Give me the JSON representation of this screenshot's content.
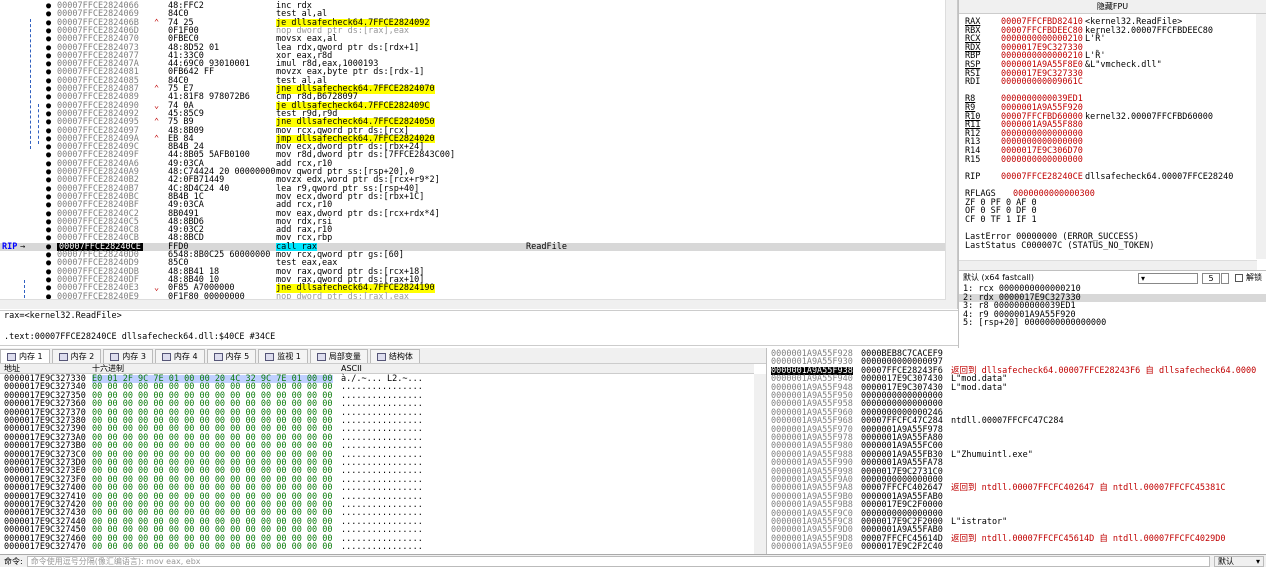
{
  "disasm": {
    "rows": [
      {
        "addr": "00007FFCE2824066",
        "bytes": "48:FFC2",
        "ins": "inc rdx",
        "cmt": "",
        "hl": "",
        "arrow": ""
      },
      {
        "addr": "00007FFCE2824069",
        "bytes": "84C0",
        "ins": "test al,al",
        "cmt": "",
        "hl": "",
        "arrow": ""
      },
      {
        "addr": "00007FFCE282406B",
        "bytes": "74 25",
        "ins": "je dllsafecheck64.7FFCE2824092",
        "cmt": "",
        "hl": "yellow",
        "arrow": "^"
      },
      {
        "addr": "00007FFCE282406D",
        "bytes": "0F1F00",
        "ins": "nop dword ptr ds:[rax],eax",
        "cmt": "",
        "hl": "nop",
        "arrow": ""
      },
      {
        "addr": "00007FFCE2824070",
        "bytes": "0FBEC0",
        "ins": "movsx eax,al",
        "cmt": "",
        "hl": "",
        "arrow": ""
      },
      {
        "addr": "00007FFCE2824073",
        "bytes": "48:8D52 01",
        "ins": "lea rdx,qword ptr ds:[rdx+1]",
        "cmt": "",
        "hl": "",
        "arrow": ""
      },
      {
        "addr": "00007FFCE2824077",
        "bytes": "41:33C0",
        "ins": "xor eax,r8d",
        "cmt": "",
        "hl": "",
        "arrow": ""
      },
      {
        "addr": "00007FFCE282407A",
        "bytes": "44:69C0 93010001",
        "ins": "imul r8d,eax,1000193",
        "cmt": "",
        "hl": "",
        "arrow": ""
      },
      {
        "addr": "00007FFCE2824081",
        "bytes": "0FB642 FF",
        "ins": "movzx eax,byte ptr ds:[rdx-1]",
        "cmt": "",
        "hl": "",
        "arrow": ""
      },
      {
        "addr": "00007FFCE2824085",
        "bytes": "84C0",
        "ins": "test al,al",
        "cmt": "",
        "hl": "",
        "arrow": ""
      },
      {
        "addr": "00007FFCE2824087",
        "bytes": "75 E7",
        "ins": "jne dllsafecheck64.7FFCE2824070",
        "cmt": "",
        "hl": "yellow",
        "arrow": "^"
      },
      {
        "addr": "00007FFCE2824089",
        "bytes": "41:81F8 978072B6",
        "ins": "cmp r8d,B6728097",
        "cmt": "",
        "hl": "",
        "arrow": ""
      },
      {
        "addr": "00007FFCE2824090",
        "bytes": "74 0A",
        "ins": "je dllsafecheck64.7FFCE282409C",
        "cmt": "",
        "hl": "yellow",
        "arrow": "v"
      },
      {
        "addr": "00007FFCE2824092",
        "bytes": "45:85C9",
        "ins": "test r9d,r9d",
        "cmt": "",
        "hl": "",
        "arrow": ""
      },
      {
        "addr": "00007FFCE2824095",
        "bytes": "75 B9",
        "ins": "jne dllsafecheck64.7FFCE2824050",
        "cmt": "",
        "hl": "yellow",
        "arrow": "^"
      },
      {
        "addr": "00007FFCE2824097",
        "bytes": "48:8B09",
        "ins": "mov rcx,qword ptr ds:[rcx]",
        "cmt": "",
        "hl": "",
        "arrow": ""
      },
      {
        "addr": "00007FFCE282409A",
        "bytes": "EB 84",
        "ins": "jmp dllsafecheck64.7FFCE2824020",
        "cmt": "",
        "hl": "yellow",
        "arrow": "^"
      },
      {
        "addr": "00007FFCE282409C",
        "bytes": "8B4B 24",
        "ins": "mov ecx,dword ptr ds:[rbx+24]",
        "cmt": "",
        "hl": "",
        "arrow": ""
      },
      {
        "addr": "00007FFCE282409F",
        "bytes": "44:8B05 5AFB0100",
        "ins": "mov r8d,dword ptr ds:[7FFCE2843C00]",
        "cmt": "",
        "hl": "",
        "arrow": ""
      },
      {
        "addr": "00007FFCE28240A6",
        "bytes": "49:03CA",
        "ins": "add rcx,r10",
        "cmt": "",
        "hl": "",
        "arrow": ""
      },
      {
        "addr": "00007FFCE28240A9",
        "bytes": "48:C74424 20 00000000",
        "ins": "mov qword ptr ss:[rsp+20],0",
        "cmt": "",
        "hl": "",
        "arrow": ""
      },
      {
        "addr": "00007FFCE28240B2",
        "bytes": "42:0FB71449",
        "ins": "movzx edx,word ptr ds:[rcx+r9*2]",
        "cmt": "",
        "hl": "",
        "arrow": ""
      },
      {
        "addr": "00007FFCE28240B7",
        "bytes": "4C:8D4C24 40",
        "ins": "lea r9,qword ptr ss:[rsp+40]",
        "cmt": "",
        "hl": "",
        "arrow": ""
      },
      {
        "addr": "00007FFCE28240BC",
        "bytes": "8B4B 1C",
        "ins": "mov ecx,dword ptr ds:[rbx+1C]",
        "cmt": "",
        "hl": "",
        "arrow": ""
      },
      {
        "addr": "00007FFCE28240BF",
        "bytes": "49:03CA",
        "ins": "add rcx,r10",
        "cmt": "",
        "hl": "",
        "arrow": ""
      },
      {
        "addr": "00007FFCE28240C2",
        "bytes": "8B0491",
        "ins": "mov eax,dword ptr ds:[rcx+rdx*4]",
        "cmt": "",
        "hl": "",
        "arrow": ""
      },
      {
        "addr": "00007FFCE28240C5",
        "bytes": "48:8BD6",
        "ins": "mov rdx,rsi",
        "cmt": "",
        "hl": "",
        "arrow": ""
      },
      {
        "addr": "00007FFCE28240C8",
        "bytes": "49:03C2",
        "ins": "add rax,r10",
        "cmt": "",
        "hl": "",
        "arrow": ""
      },
      {
        "addr": "00007FFCE28240CB",
        "bytes": "48:8BCD",
        "ins": "mov rcx,rbp",
        "cmt": "",
        "hl": "",
        "arrow": ""
      },
      {
        "addr": "00007FFCE28240CE",
        "bytes": "FFD0",
        "ins": "call rax",
        "cmt": "ReadFile",
        "hl": "call",
        "arrow": "",
        "rip": true
      },
      {
        "addr": "00007FFCE28240D0",
        "bytes": "6548:8B0C25 60000000",
        "ins": "mov rcx,qword ptr gs:[60]",
        "cmt": "",
        "hl": "",
        "arrow": ""
      },
      {
        "addr": "00007FFCE28240D9",
        "bytes": "85C0",
        "ins": "test eax,eax",
        "cmt": "",
        "hl": "",
        "arrow": ""
      },
      {
        "addr": "00007FFCE28240DB",
        "bytes": "48:8B41 18",
        "ins": "mov rax,qword ptr ds:[rcx+18]",
        "cmt": "",
        "hl": "",
        "arrow": ""
      },
      {
        "addr": "00007FFCE28240DF",
        "bytes": "48:8B40 10",
        "ins": "mov rax,qword ptr ds:[rax+10]",
        "cmt": "",
        "hl": "",
        "arrow": ""
      },
      {
        "addr": "00007FFCE28240E3",
        "bytes": "0F85 A7000000",
        "ins": "jne dllsafecheck64.7FFCE2824190",
        "cmt": "",
        "hl": "yellow",
        "arrow": "v"
      },
      {
        "addr": "00007FFCE28240E9",
        "bytes": "0F1F80 00000000",
        "ins": "nop dword ptr ds:[rax],eax",
        "cmt": "",
        "hl": "nop",
        "arrow": ""
      }
    ],
    "rip_label": "RIP"
  },
  "info": {
    "line1": "rax=<kernel32.ReadFile>",
    "line2": ".text:00007FFCE28240CE dllsafecheck64.dll:$40CE #34CE"
  },
  "regs": {
    "title": "隐藏FPU",
    "rows": [
      {
        "n": "RAX",
        "v": "00007FFCFBD82410",
        "c": "<kernel32.ReadFile>",
        "u": true
      },
      {
        "n": "RBX",
        "v": "00007FFCFBDEEC80",
        "c": "kernel32.00007FFCFBDEEC80",
        "u": false
      },
      {
        "n": "RCX",
        "v": "0000000000000210",
        "c": "L'Ȑ'",
        "u": true
      },
      {
        "n": "RDX",
        "v": "0000017E9C327330",
        "c": "",
        "u": true
      },
      {
        "n": "RBP",
        "v": "0000000000000210",
        "c": "L'Ȑ'",
        "u": false
      },
      {
        "n": "RSP",
        "v": "0000001A9A55F8E0",
        "c": "&L\"vmcheck.dll\"",
        "u": true
      },
      {
        "n": "RSI",
        "v": "0000017E9C327330",
        "c": "",
        "u": false
      },
      {
        "n": "RDI",
        "v": "000000000009061C",
        "c": "",
        "u": false
      },
      {
        "n": "",
        "v": "",
        "c": "",
        "u": false
      },
      {
        "n": "R8",
        "v": "0000000000039ED1",
        "c": "",
        "u": true
      },
      {
        "n": "R9",
        "v": "0000001A9A55F920",
        "c": "",
        "u": true
      },
      {
        "n": "R10",
        "v": "00007FFCFBD60000",
        "c": "kernel32.00007FFCFBD60000",
        "u": true
      },
      {
        "n": "R11",
        "v": "0000001A9A55F880",
        "c": "",
        "u": true
      },
      {
        "n": "R12",
        "v": "0000000000000000",
        "c": "",
        "u": false
      },
      {
        "n": "R13",
        "v": "0000000000000000",
        "c": "",
        "u": false
      },
      {
        "n": "R14",
        "v": "0000017E9C306D70",
        "c": "",
        "u": false
      },
      {
        "n": "R15",
        "v": "0000000000000000",
        "c": "",
        "u": false
      },
      {
        "n": "",
        "v": "",
        "c": "",
        "u": false
      },
      {
        "n": "RIP",
        "v": "00007FFCE28240CE",
        "c": "dllsafecheck64.00007FFCE28240",
        "u": false
      },
      {
        "n": "",
        "v": "",
        "c": "",
        "u": false
      },
      {
        "n": "RFLAGS",
        "v": "0000000000000300",
        "c": "",
        "u": false
      },
      {
        "n": "ZF 0  PF 0  AF 0",
        "v": "",
        "c": "",
        "u": false,
        "plain": true
      },
      {
        "n": "OF 0  SF 0  DF 0",
        "v": "",
        "c": "",
        "u": false,
        "plain": true
      },
      {
        "n": "CF 0  TF 1  IF 1",
        "v": "",
        "c": "",
        "u": false,
        "plain": true
      },
      {
        "n": "",
        "v": "",
        "c": "",
        "u": false
      },
      {
        "n": "LastError  00000000 (ERROR_SUCCESS)",
        "v": "",
        "c": "",
        "u": false,
        "plain": true
      },
      {
        "n": "LastStatus C000007C (STATUS_NO_TOKEN)",
        "v": "",
        "c": "",
        "u": false,
        "plain": true
      }
    ]
  },
  "callconv": {
    "label": "默认 (x64 fastcall)",
    "count": "5",
    "lock_label": "解锁",
    "rows": [
      "1: rcx 0000000000000210",
      "2: rdx 0000017E9C327330",
      "3: r8 0000000000039ED1",
      "4: r9 0000001A9A55F920",
      "5: [rsp+20] 0000000000000000"
    ],
    "selected": 1
  },
  "tabs": [
    {
      "label": "内存 1",
      "active": true
    },
    {
      "label": "内存 2",
      "active": false
    },
    {
      "label": "内存 3",
      "active": false
    },
    {
      "label": "内存 4",
      "active": false
    },
    {
      "label": "内存 5",
      "active": false
    },
    {
      "label": "监视 1",
      "active": false
    },
    {
      "label": "局部变量",
      "active": false
    },
    {
      "label": "结构体",
      "active": false
    }
  ],
  "dump": {
    "head_addr": "地址",
    "head_hex": "十六进制",
    "head_ascii": "ASCII",
    "rows": [
      {
        "a": "0000017E9C327330",
        "h": "E0 01 2F 9C 7E 01 00 00 20 4C 32 9C 7E 01 00 00",
        "c": "à./.~... L2.~..."
      },
      {
        "a": "0000017E9C327340",
        "h": "00 00 00 00 00 00 00 00 00 00 00 00 00 00 00 00",
        "c": "................"
      },
      {
        "a": "0000017E9C327350",
        "h": "00 00 00 00 00 00 00 00 00 00 00 00 00 00 00 00",
        "c": "................"
      },
      {
        "a": "0000017E9C327360",
        "h": "00 00 00 00 00 00 00 00 00 00 00 00 00 00 00 00",
        "c": "................"
      },
      {
        "a": "0000017E9C327370",
        "h": "00 00 00 00 00 00 00 00 00 00 00 00 00 00 00 00",
        "c": "................"
      },
      {
        "a": "0000017E9C327380",
        "h": "00 00 00 00 00 00 00 00 00 00 00 00 00 00 00 00",
        "c": "................"
      },
      {
        "a": "0000017E9C327390",
        "h": "00 00 00 00 00 00 00 00 00 00 00 00 00 00 00 00",
        "c": "................"
      },
      {
        "a": "0000017E9C3273A0",
        "h": "00 00 00 00 00 00 00 00 00 00 00 00 00 00 00 00",
        "c": "................"
      },
      {
        "a": "0000017E9C3273B0",
        "h": "00 00 00 00 00 00 00 00 00 00 00 00 00 00 00 00",
        "c": "................"
      },
      {
        "a": "0000017E9C3273C0",
        "h": "00 00 00 00 00 00 00 00 00 00 00 00 00 00 00 00",
        "c": "................"
      },
      {
        "a": "0000017E9C3273D0",
        "h": "00 00 00 00 00 00 00 00 00 00 00 00 00 00 00 00",
        "c": "................"
      },
      {
        "a": "0000017E9C3273E0",
        "h": "00 00 00 00 00 00 00 00 00 00 00 00 00 00 00 00",
        "c": "................"
      },
      {
        "a": "0000017E9C3273F0",
        "h": "00 00 00 00 00 00 00 00 00 00 00 00 00 00 00 00",
        "c": "................"
      },
      {
        "a": "0000017E9C327400",
        "h": "00 00 00 00 00 00 00 00 00 00 00 00 00 00 00 00",
        "c": "................"
      },
      {
        "a": "0000017E9C327410",
        "h": "00 00 00 00 00 00 00 00 00 00 00 00 00 00 00 00",
        "c": "................"
      },
      {
        "a": "0000017E9C327420",
        "h": "00 00 00 00 00 00 00 00 00 00 00 00 00 00 00 00",
        "c": "................"
      },
      {
        "a": "0000017E9C327430",
        "h": "00 00 00 00 00 00 00 00 00 00 00 00 00 00 00 00",
        "c": "................"
      },
      {
        "a": "0000017E9C327440",
        "h": "00 00 00 00 00 00 00 00 00 00 00 00 00 00 00 00",
        "c": "................"
      },
      {
        "a": "0000017E9C327450",
        "h": "00 00 00 00 00 00 00 00 00 00 00 00 00 00 00 00",
        "c": "................"
      },
      {
        "a": "0000017E9C327460",
        "h": "00 00 00 00 00 00 00 00 00 00 00 00 00 00 00 00",
        "c": "................"
      },
      {
        "a": "0000017E9C327470",
        "h": "00 00 00 00 00 00 00 00 00 00 00 00 00 00 00 00",
        "c": "................"
      }
    ]
  },
  "stack": {
    "rows": [
      {
        "a": "0000001A9A55F928",
        "v": "0000BEB8C7CACEF9",
        "c": "",
        "red": false
      },
      {
        "a": "0000001A9A55F930",
        "v": "0000000000000097",
        "c": "",
        "red": false
      },
      {
        "a": "0000001A9A55F938",
        "v": "00007FFCE28243F6",
        "c": "返回到 dllsafecheck64.00007FFCE28243F6 自 dllsafecheck64.0000",
        "red": true
      },
      {
        "a": "0000001A9A55F940",
        "v": "0000017E9C307430",
        "c": "L\"mod.data\"",
        "red": false
      },
      {
        "a": "0000001A9A55F948",
        "v": "0000017E9C307430",
        "c": "L\"mod.data\"",
        "red": false
      },
      {
        "a": "0000001A9A55F950",
        "v": "0000000000000000",
        "c": "",
        "red": false
      },
      {
        "a": "0000001A9A55F958",
        "v": "0000000000000000",
        "c": "",
        "red": false
      },
      {
        "a": "0000001A9A55F960",
        "v": "0000000000000246",
        "c": "",
        "red": false
      },
      {
        "a": "0000001A9A55F968",
        "v": "00007FFCFC47C284",
        "c": "ntdll.00007FFCFC47C284",
        "red": false
      },
      {
        "a": "0000001A9A55F970",
        "v": "0000001A9A55F978",
        "c": "",
        "red": false
      },
      {
        "a": "0000001A9A55F978",
        "v": "0000001A9A55FA80",
        "c": "",
        "red": false
      },
      {
        "a": "0000001A9A55F980",
        "v": "0000001A9A55FC00",
        "c": "",
        "red": false
      },
      {
        "a": "0000001A9A55F988",
        "v": "0000001A9A55FB30",
        "c": "L\"Zhumuintl.exe\"",
        "red": false
      },
      {
        "a": "0000001A9A55F990",
        "v": "0000001A9A55FA78",
        "c": "",
        "red": false
      },
      {
        "a": "0000001A9A55F998",
        "v": "0000017E9C2731C0",
        "c": "",
        "red": false
      },
      {
        "a": "0000001A9A55F9A0",
        "v": "0000000000000000",
        "c": "",
        "red": false
      },
      {
        "a": "0000001A9A55F9A8",
        "v": "00007FFCFC402647",
        "c": "返回到 ntdll.00007FFCFC402647 自 ntdll.00007FFCFC45381C",
        "red": true
      },
      {
        "a": "0000001A9A55F9B0",
        "v": "0000001A9A55FAB0",
        "c": "",
        "red": false
      },
      {
        "a": "0000001A9A55F9B8",
        "v": "0000017E9C2F0000",
        "c": "",
        "red": false
      },
      {
        "a": "0000001A9A55F9C0",
        "v": "0000000000000000",
        "c": "",
        "red": false
      },
      {
        "a": "0000001A9A55F9C8",
        "v": "0000017E9C2F2000",
        "c": "L\"istrator\"",
        "red": false
      },
      {
        "a": "0000001A9A55F9D0",
        "v": "0000001A9A55FAB0",
        "c": "",
        "red": false
      },
      {
        "a": "0000001A9A55F9D8",
        "v": "00007FFCFC45614D",
        "c": "返回到 ntdll.00007FFCFC45614D 自 ntdll.00007FFCFC4029D0",
        "red": true
      },
      {
        "a": "0000001A9A55F9E0",
        "v": "0000017E9C2F2C40",
        "c": "",
        "red": false
      }
    ]
  },
  "cmd": {
    "label": "命令:",
    "placeholder": "命令使用逗号分隔(像汇编语言): mov eax, ebx",
    "mode": "默认"
  }
}
